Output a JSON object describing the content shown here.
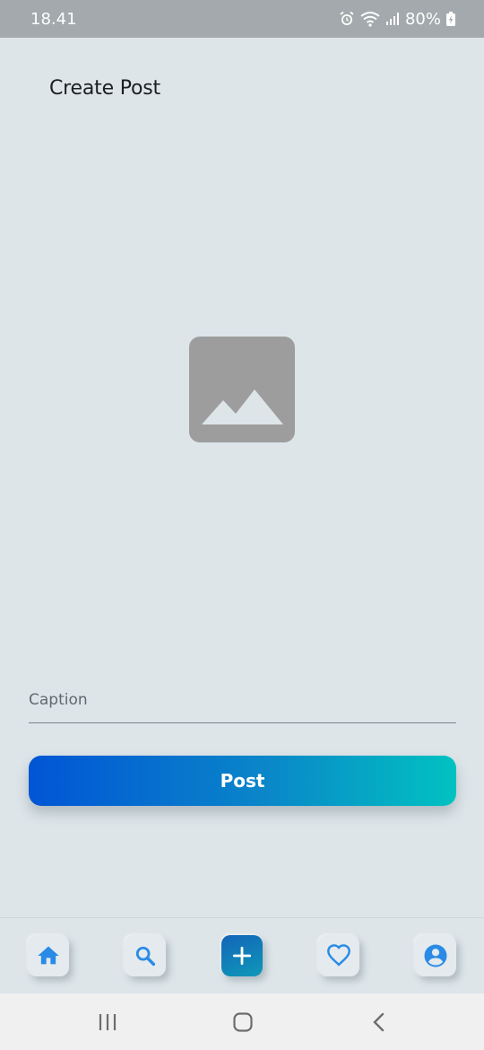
{
  "status_bar": {
    "time": "18.41",
    "battery": "80%",
    "icons": [
      "alarm-icon",
      "wifi-icon",
      "signal-icon",
      "battery-charging-icon"
    ]
  },
  "header": {
    "title": "Create Post"
  },
  "image_picker": {
    "icon": "image-placeholder-icon"
  },
  "caption": {
    "placeholder": "Caption",
    "value": ""
  },
  "post_button": {
    "label": "Post"
  },
  "bottom_nav": {
    "items": [
      {
        "name": "home",
        "icon": "home-icon",
        "active": false
      },
      {
        "name": "search",
        "icon": "search-icon",
        "active": false
      },
      {
        "name": "create",
        "icon": "plus-icon",
        "active": true
      },
      {
        "name": "favorites",
        "icon": "heart-icon",
        "active": false
      },
      {
        "name": "profile",
        "icon": "profile-icon",
        "active": false
      }
    ]
  },
  "system_nav": {
    "items": [
      "recents-button",
      "home-button",
      "back-button"
    ]
  },
  "colors": {
    "background": "#dde5e9",
    "accent_blue": "#2a8be6",
    "gradient_start": "#0155d5",
    "gradient_end": "#01c2c1",
    "status_bar": "#a3a9ac"
  }
}
